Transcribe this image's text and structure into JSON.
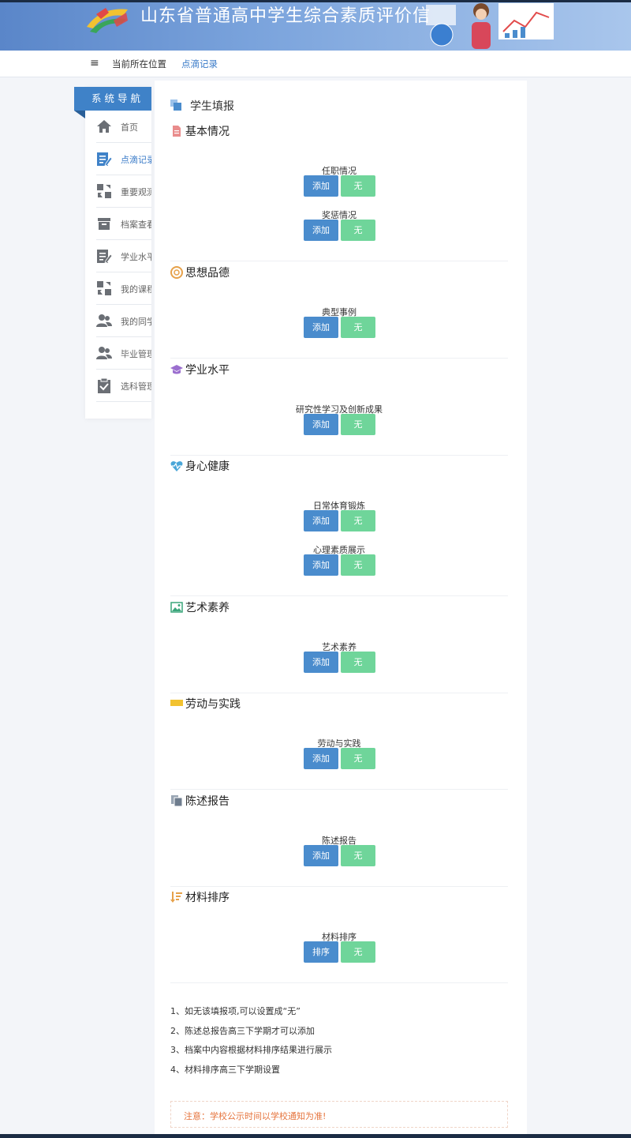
{
  "header": {
    "title": "山东省普通高中学生综合素质评价信"
  },
  "breadcrumb": {
    "label": "当前所在位置",
    "current": "点滴记录"
  },
  "sidebar": {
    "title": "系统导航",
    "items": [
      {
        "label": "首页",
        "icon": "home-icon"
      },
      {
        "label": "点滴记录",
        "icon": "edit-icon"
      },
      {
        "label": "重要观测",
        "icon": "swap-icon"
      },
      {
        "label": "档案查看",
        "icon": "archive-icon"
      },
      {
        "label": "学业水平",
        "icon": "edit-icon"
      },
      {
        "label": "我的课程",
        "icon": "swap-icon"
      },
      {
        "label": "我的同学",
        "icon": "users-icon"
      },
      {
        "label": "毕业管理",
        "icon": "users-icon"
      },
      {
        "label": "选科管理",
        "icon": "clipboard-check-icon"
      }
    ],
    "active_index": 1
  },
  "main": {
    "title": "学生填报",
    "add_label": "添加",
    "none_label": "无",
    "sort_label": "排序",
    "sections": [
      {
        "title": "基本情况",
        "icon": "file-icon",
        "fields": [
          "任职情况",
          "奖惩情况"
        ]
      },
      {
        "title": "思想品德",
        "icon": "lifebuoy-icon",
        "fields": [
          "典型事例"
        ]
      },
      {
        "title": "学业水平",
        "icon": "graduation-cap-icon",
        "fields": [
          "研究性学习及创新成果"
        ]
      },
      {
        "title": "身心健康",
        "icon": "heartbeat-icon",
        "fields": [
          "日常体育锻炼",
          "心理素质展示"
        ]
      },
      {
        "title": "艺术素养",
        "icon": "image-icon",
        "fields": [
          "艺术素养"
        ]
      },
      {
        "title": "劳动与实践",
        "icon": "flag-icon",
        "fields": [
          "劳动与实践"
        ]
      },
      {
        "title": "陈述报告",
        "icon": "copy-icon",
        "fields": [
          "陈述报告"
        ]
      },
      {
        "title": "材料排序",
        "icon": "sort-icon",
        "fields": [
          "材料排序"
        ]
      }
    ],
    "notes": [
      "1、如无该填报项,可以设置成“无”",
      "2、陈述总报告高三下学期才可以添加",
      "3、档案中内容根据材料排序结果进行展示",
      "4、材料排序高三下学期设置"
    ],
    "notice": "注意：学校公示时间以学校通知为准!"
  },
  "colors": {
    "primary": "#4a8ccd",
    "success": "#6fd59a",
    "nav_header": "#3f82c8",
    "notice": "#e6743d"
  }
}
